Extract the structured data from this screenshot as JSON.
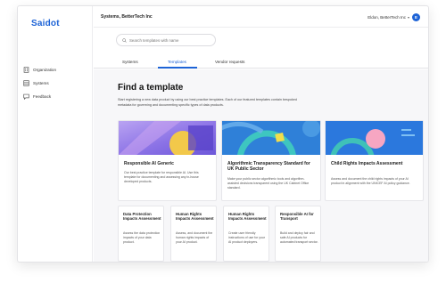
{
  "app": {
    "logo": "Saidot"
  },
  "sidebar": {
    "items": [
      {
        "label": "Organization",
        "icon": "building-icon"
      },
      {
        "label": "Systems",
        "icon": "grid-icon"
      },
      {
        "label": "Feedback",
        "icon": "chat-icon"
      }
    ]
  },
  "header": {
    "org": "Systems, BetterTech Inc",
    "user": "Eldon, BetterTech Inc",
    "avatar": "E"
  },
  "search": {
    "placeholder": "Search templates with name"
  },
  "tabs": [
    {
      "label": "Systems",
      "active": false
    },
    {
      "label": "Templates",
      "active": true
    },
    {
      "label": "Vendor requests",
      "active": false
    }
  ],
  "page": {
    "title": "Find a template",
    "description": "Start registering a new data product by using our best practice templates. Each of our featured templates contain bespoked metadata for governing and documenting specific types of data products."
  },
  "featured": [
    {
      "title": "Responsible AI Generic",
      "description": "Our best practice template for responsible AI. Use this template for documenting and assessing any in-house developed products."
    },
    {
      "title": "Algorithmic Transparency Standard for UK Public Sector",
      "description": "Make your public sector algorithmic tools and algorithm-assisted decisions transparent using the UK Cabinet Office standard."
    },
    {
      "title": "Child Rights Impacts Assessment",
      "description": "Assess and document the child rights impacts of your AI product in alignment with the UNICEF AI policy guidance."
    }
  ],
  "small": [
    {
      "title": "Data Protection Impacts Assessment",
      "description": "Assess the data protection impacts of your data product."
    },
    {
      "title": "Human Rights Impacts Assessment",
      "description": "Assess, and document the human rights impacts of your AI product."
    },
    {
      "title": "Human Rights Impacts Assessment",
      "description": "Create user friendly instructions of use for your AI product deployers."
    },
    {
      "title": "Responsible AI for Transport",
      "description": "Build and deploy fair and safe AI products for automated transport sector."
    }
  ],
  "colors": {
    "accent": "#1d63d6"
  }
}
